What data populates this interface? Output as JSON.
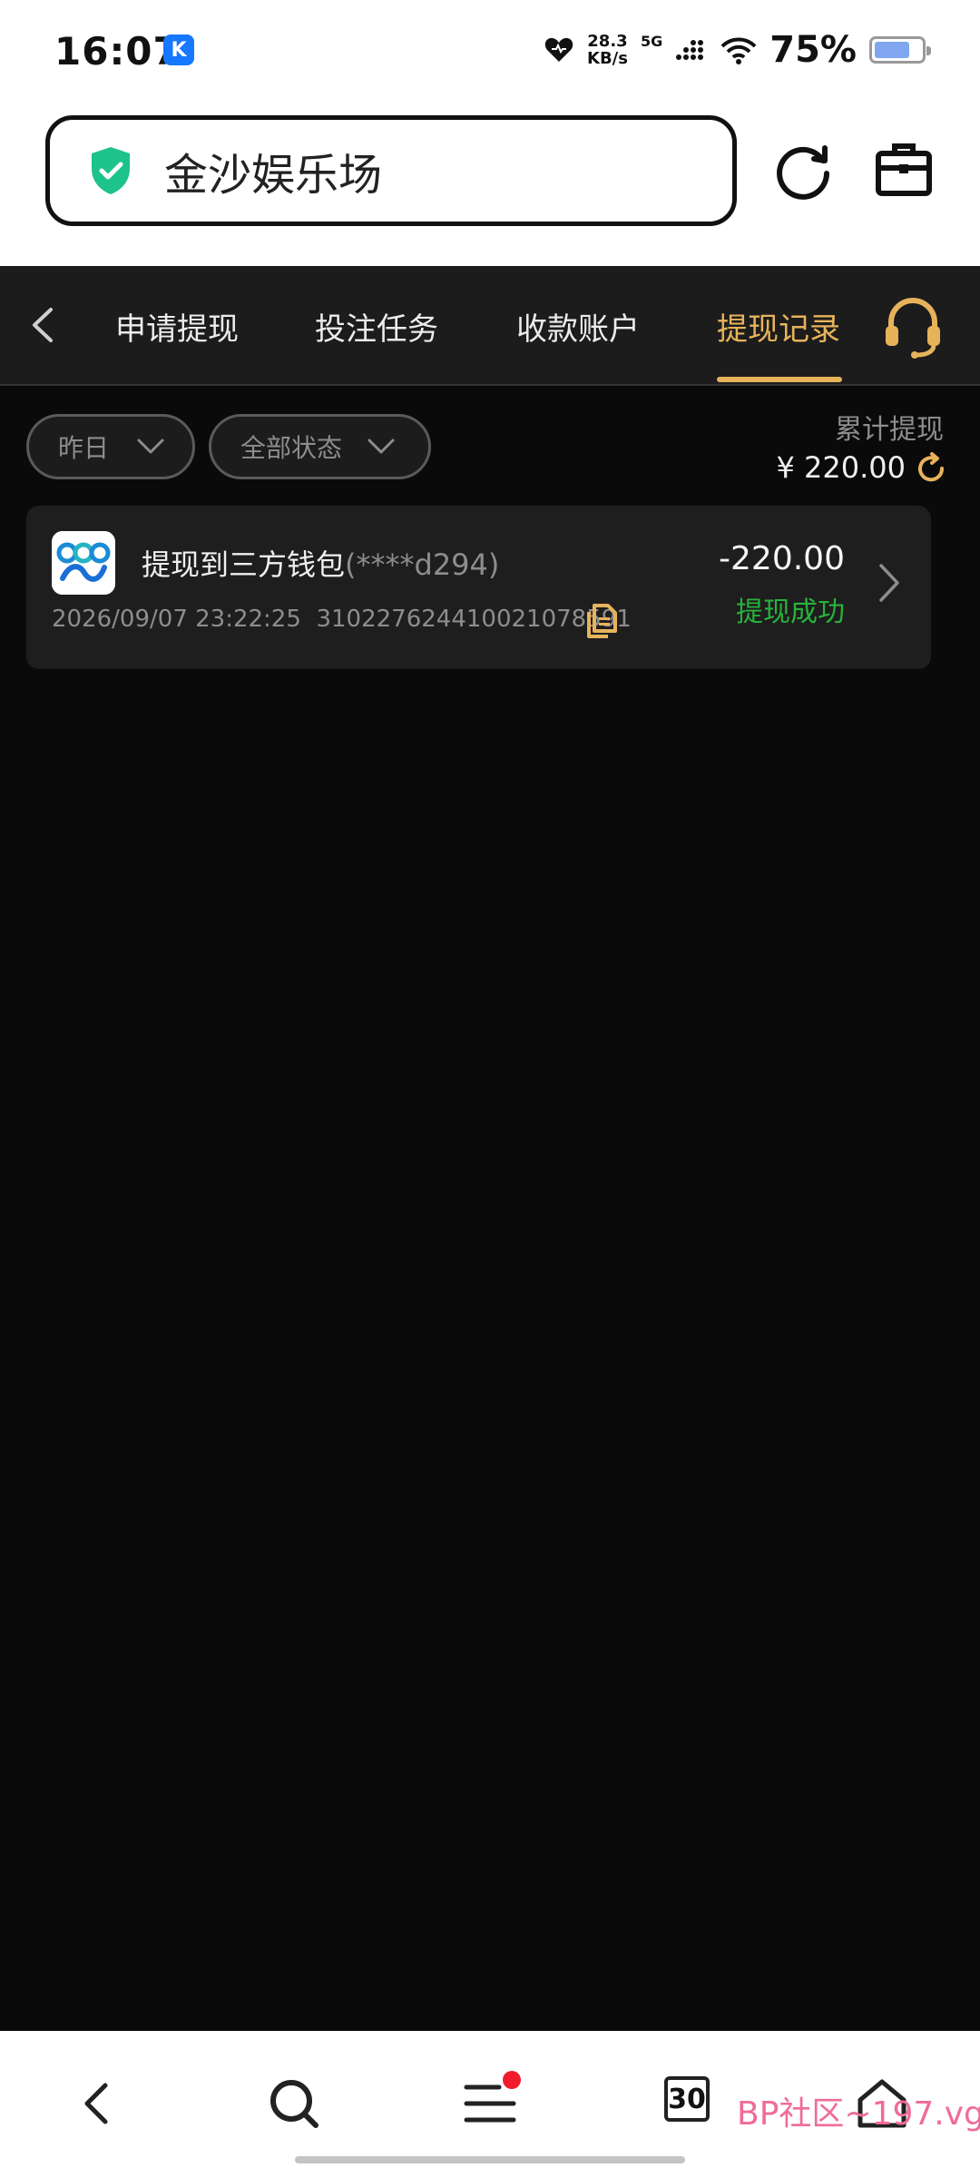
{
  "status_bar": {
    "time": "16:07",
    "k_badge": "K",
    "speed_value": "28.3",
    "speed_unit": "KB/s",
    "network": "5G",
    "battery_pct": "75%",
    "battery_level": 0.75
  },
  "address_bar": {
    "site_title": "金沙娱乐场",
    "icons": [
      "shield-check-icon",
      "reload-icon",
      "toolbox-icon"
    ],
    "shield_color": "#1ec28b"
  },
  "header": {
    "tabs": [
      {
        "label": "申请提现",
        "active": false
      },
      {
        "label": "投注任务",
        "active": false
      },
      {
        "label": "收款账户",
        "active": false
      },
      {
        "label": "提现记录",
        "active": true
      }
    ],
    "accent_color": "#e7b35a"
  },
  "filters": {
    "date": "昨日",
    "status": "全部状态"
  },
  "summary": {
    "label": "累计提现",
    "value": "¥ 220.00"
  },
  "records": [
    {
      "title": "提现到三方钱包",
      "account": "(****d294)",
      "datetime": "2026/09/07 23:22:25",
      "order_no": "310227624410021078591",
      "amount": "-220.00",
      "status": "提现成功",
      "status_color": "#27b33c"
    }
  ],
  "bottom_nav": {
    "tabs_count": "30",
    "watermark": "BP社区~197.vg"
  }
}
